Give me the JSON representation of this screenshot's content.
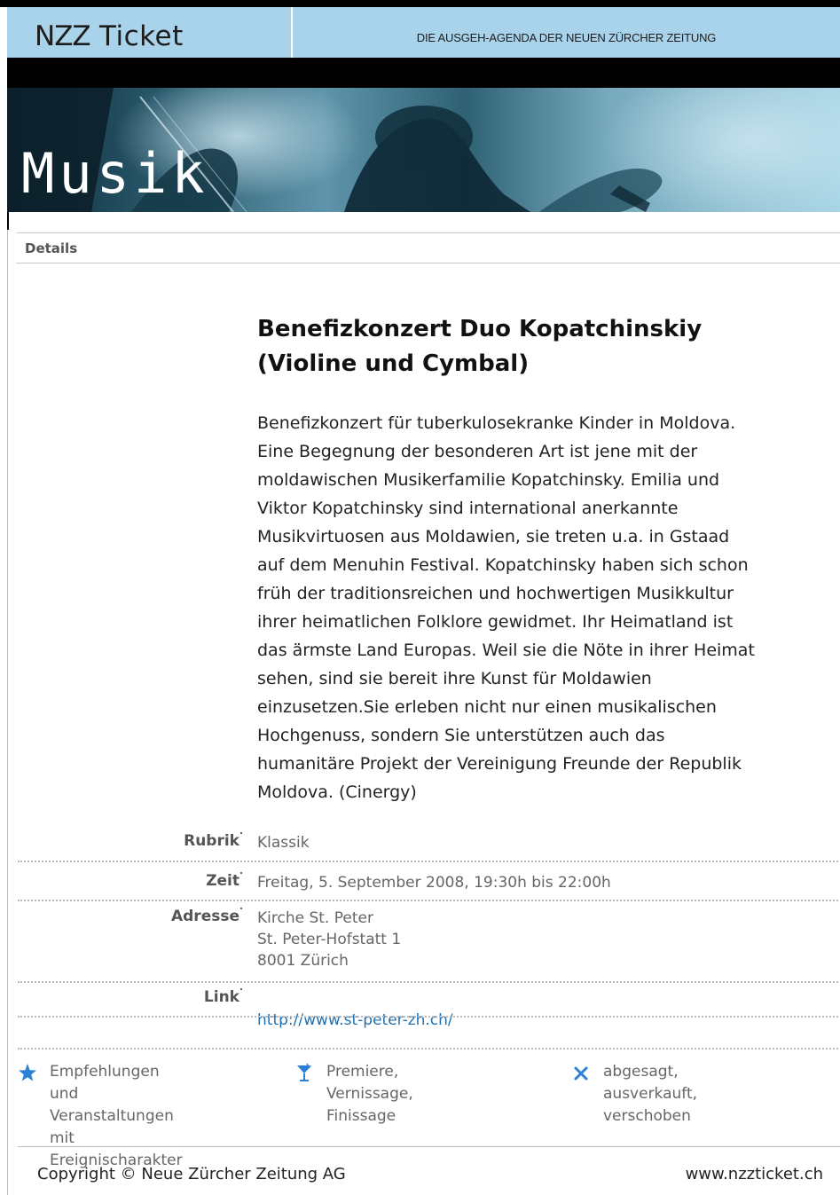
{
  "header": {
    "logo_nzz": "NZZ",
    "logo_ticket": "Ticket",
    "tagline": "DIE AUSGEH-AGENDA DER NEUEN ZÜRCHER ZEITUNG",
    "background_color": "#a9d3ea"
  },
  "banner": {
    "title": "Musik"
  },
  "details_label": "Details",
  "event": {
    "title": "Benefizkonzert Duo Kopatchinskiy\n(Violine und Cymbal)",
    "description": "Benefizkonzert für tuberkulosekranke Kinder in Moldova.\nEine Begegnung der besonderen Art ist jene mit der\nmoldawischen Musikerfamilie Kopatchinsky. Emilia und\nViktor Kopatchinsky sind international anerkannte\nMusikvirtuosen aus Moldawien, sie treten u.a. in Gstaad\nauf dem Menuhin Festival. Kopatchinsky haben sich schon\nfrüh der traditionsreichen und hochwertigen Musikkultur\nihrer heimatlichen Folklore gewidmet. Ihr Heimatland ist\ndas ärmste Land Europas. Weil sie die Nöte in ihrer Heimat\nsehen, sind sie bereit ihre Kunst für Moldawien\neinzusetzen.Sie erleben nicht nur einen musikalischen\nHochgenuss, sondern Sie unterstützen auch das\nhumanitäre Projekt der Vereinigung Freunde der Republik\nMoldova. (Cinergy)"
  },
  "info": {
    "rubrik_label": "Rubrik",
    "rubrik_value": "Klassik",
    "zeit_label": "Zeit",
    "zeit_value": "Freitag, 5. September 2008, 19:30h bis 22:00h",
    "adresse_label": "Adresse",
    "adresse_value": "Kirche St. Peter\nSt. Peter-Hofstatt 1\n8001 Zürich",
    "link_label": "Link",
    "link_value": "http://www.st-peter-zh.ch/"
  },
  "legend": {
    "items": [
      {
        "icon": "star-icon",
        "text": "Empfehlungen und\nVeranstaltungen mit\nEreignischarakter"
      },
      {
        "icon": "cocktail-glass-icon",
        "text": "Premiere, Vernissage,\nFinissage"
      },
      {
        "icon": "cross-icon",
        "text": "abgesagt, ausverkauft,\nverschoben"
      }
    ],
    "icon_color": "#2b7fd4"
  },
  "footer": {
    "copyright": "Copyright © Neue Zürcher Zeitung AG",
    "site": "www.nzzticket.ch"
  },
  "colors": {
    "link": "#1f6fb0",
    "label": "#555555",
    "value": "#666666"
  }
}
